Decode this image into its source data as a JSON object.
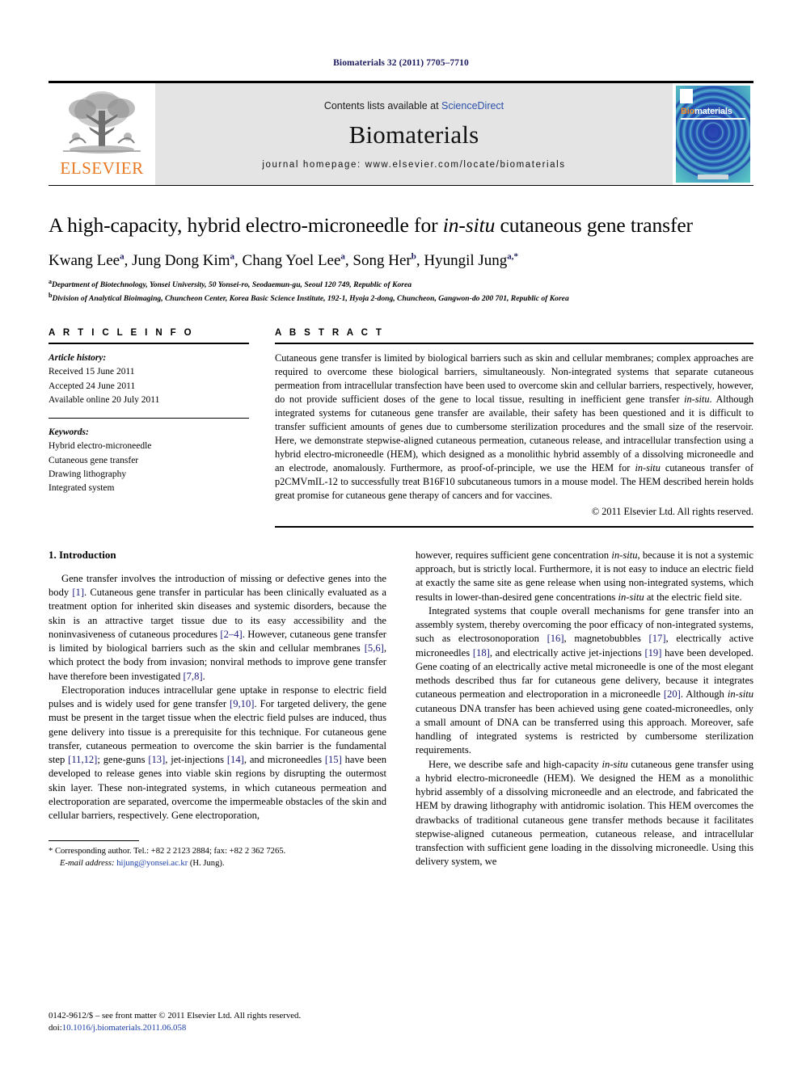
{
  "running_head": "Biomaterials 32 (2011) 7705–7710",
  "masthead": {
    "publisher_name": "ELSEVIER",
    "contents_prefix": "Contents lists available at ",
    "sciencedirect": "ScienceDirect",
    "journal_name": "Biomaterials",
    "homepage": "journal homepage: www.elsevier.com/locate/biomaterials",
    "cover": {
      "title_bio": "Bio",
      "title_rest": "materials"
    }
  },
  "title": {
    "part1": "A high-capacity, hybrid electro-microneedle for ",
    "italic": "in-situ",
    "part2": " cutaneous gene transfer"
  },
  "authors": [
    {
      "name": "Kwang Lee",
      "sup": "a",
      "sep": ", "
    },
    {
      "name": "Jung Dong Kim",
      "sup": "a",
      "sep": ", "
    },
    {
      "name": "Chang Yoel Lee",
      "sup": "a",
      "sep": ", "
    },
    {
      "name": "Song Her",
      "sup": "b",
      "sep": ", "
    },
    {
      "name": "Hyungil Jung",
      "sup": "a,*",
      "sep": ""
    }
  ],
  "affiliations": [
    {
      "mark": "a",
      "text": "Department of Biotechnology, Yonsei University, 50 Yonsei-ro, Seodaemun-gu, Seoul 120 749, Republic of Korea"
    },
    {
      "mark": "b",
      "text": "Division of Analytical Bioimaging, Chuncheon Center, Korea Basic Science Institute, 192-1, Hyoja 2-dong, Chuncheon, Gangwon-do 200 701, Republic of Korea"
    }
  ],
  "article_info": {
    "heading": "A R T I C L E   I N F O",
    "history_label": "Article history:",
    "history": [
      "Received 15 June 2011",
      "Accepted 24 June 2011",
      "Available online 20 July 2011"
    ],
    "keywords_label": "Keywords:",
    "keywords": [
      "Hybrid electro-microneedle",
      "Cutaneous gene transfer",
      "Drawing lithography",
      "Integrated system"
    ]
  },
  "abstract": {
    "heading": "A B S T R A C T",
    "p1": "Cutaneous gene transfer is limited by biological barriers such as skin and cellular membranes; complex approaches are required to overcome these biological barriers, simultaneously. Non-integrated systems that separate cutaneous permeation from intracellular transfection have been used to overcome skin and cellular barriers, respectively, however, do not provide sufficient doses of the gene to local tissue, resulting in inefficient gene transfer ",
    "i1": "in-situ",
    "p2": ". Although integrated systems for cutaneous gene transfer are available, their safety has been questioned and it is difficult to transfer sufficient amounts of genes due to cumbersome sterilization procedures and the small size of the reservoir. Here, we demonstrate stepwise-aligned cutaneous permeation, cutaneous release, and intracellular transfection using a hybrid electro-microneedle (HEM), which designed as a monolithic hybrid assembly of a dissolving microneedle and an electrode, anomalously. Furthermore, as proof-of-principle, we use the HEM for ",
    "i2": "in-situ",
    "p3": " cutaneous transfer of p2CMVmIL-12 to successfully treat B16F10 subcutaneous tumors in a mouse model. The HEM described herein holds great promise for cutaneous gene therapy of cancers and for vaccines.",
    "copyright": "© 2011 Elsevier Ltd. All rights reserved."
  },
  "body": {
    "section_title": "1.  Introduction",
    "left": {
      "p1_a": "Gene transfer involves the introduction of missing or defective genes into the body ",
      "r1": "[1]",
      "p1_b": ". Cutaneous gene transfer in particular has been clinically evaluated as a treatment option for inherited skin diseases and systemic disorders, because the skin is an attractive target tissue due to its easy accessibility and the noninvasiveness of cutaneous procedures ",
      "r2": "[2–4]",
      "p1_c": ". However, cutaneous gene transfer is limited by biological barriers such as the skin and cellular membranes ",
      "r3": "[5,6]",
      "p1_d": ", which protect the body from invasion; nonviral methods to improve gene transfer have therefore been investigated ",
      "r4": "[7,8]",
      "p1_e": ".",
      "p2_a": "Electroporation induces intracellular gene uptake in response to electric field pulses and is widely used for gene transfer ",
      "r5": "[9,10]",
      "p2_b": ". For targeted delivery, the gene must be present in the target tissue when the electric field pulses are induced, thus gene delivery into tissue is a prerequisite for this technique. For cutaneous gene transfer, cutaneous permeation to overcome the skin barrier is the fundamental step ",
      "r6": "[11,12]",
      "p2_c": "; gene-guns ",
      "r7": "[13]",
      "p2_d": ", jet-injections ",
      "r8": "[14]",
      "p2_e": ", and microneedles ",
      "r9": "[15]",
      "p2_f": " have been developed to release genes into viable skin regions by disrupting the outermost skin layer. These non-integrated systems, in which cutaneous permeation and electroporation are separated, overcome the impermeable obstacles of the skin and cellular barriers, respectively. Gene electroporation,"
    },
    "right": {
      "p2_cont_a": "however, requires sufficient gene concentration ",
      "i1": "in-situ",
      "p2_cont_b": ", because it is not a systemic approach, but is strictly local. Furthermore, it is not easy to induce an electric field at exactly the same site as gene release when using non-integrated systems, which results in lower-than-desired gene concentrations ",
      "i2": "in-situ",
      "p2_cont_c": " at the electric field site.",
      "p3_a": "Integrated systems that couple overall mechanisms for gene transfer into an assembly system, thereby overcoming the poor efficacy of non-integrated systems, such as electrosonoporation ",
      "r1": "[16]",
      "p3_b": ", magnetobubbles ",
      "r2": "[17]",
      "p3_c": ", electrically active microneedles ",
      "r3": "[18]",
      "p3_d": ", and electrically active jet-injections ",
      "r4": "[19]",
      "p3_e": " have been developed. Gene coating of an electrically active metal microneedle is one of the most elegant methods described thus far for cutaneous gene delivery, because it integrates cutaneous permeation and electroporation in a microneedle ",
      "r5": "[20]",
      "p3_f": ". Although ",
      "i3": "in-situ",
      "p3_g": " cutaneous DNA transfer has been achieved using gene coated-microneedles, only a small amount of DNA can be transferred using this approach. Moreover, safe handling of integrated systems is restricted by cumbersome sterilization requirements.",
      "p4_a": "Here, we describe safe and high-capacity ",
      "i4": "in-situ",
      "p4_b": " cutaneous gene transfer using a hybrid electro-microneedle (HEM). We designed the HEM as a monolithic hybrid assembly of a dissolving microneedle and an electrode, and fabricated the HEM by drawing lithography with antidromic isolation. This HEM overcomes the drawbacks of traditional cutaneous gene transfer methods because it facilitates stepwise-aligned cutaneous permeation, cutaneous release, and intracellular transfection with sufficient gene loading in the dissolving microneedle. Using this delivery system, we"
    }
  },
  "footnote": {
    "star": "*",
    "corresponding": " Corresponding author. Tel.: +82 2 2123 2884; fax: +82 2 362 7265.",
    "email_label": "E-mail address:",
    "email": "hijung@yonsei.ac.kr",
    "email_suffix": " (H. Jung)."
  },
  "footer": {
    "issn_line": "0142-9612/$ – see front matter © 2011 Elsevier Ltd. All rights reserved.",
    "doi_label": "doi:",
    "doi": "10.1016/j.biomaterials.2011.06.058"
  },
  "colors": {
    "elsevier_orange": "#E87722",
    "link_blue": "#1a3fa8",
    "ref_blue": "#1a1a7a",
    "header_navy": "#1a1a5e",
    "banner_grey": "#e4e4e4"
  }
}
